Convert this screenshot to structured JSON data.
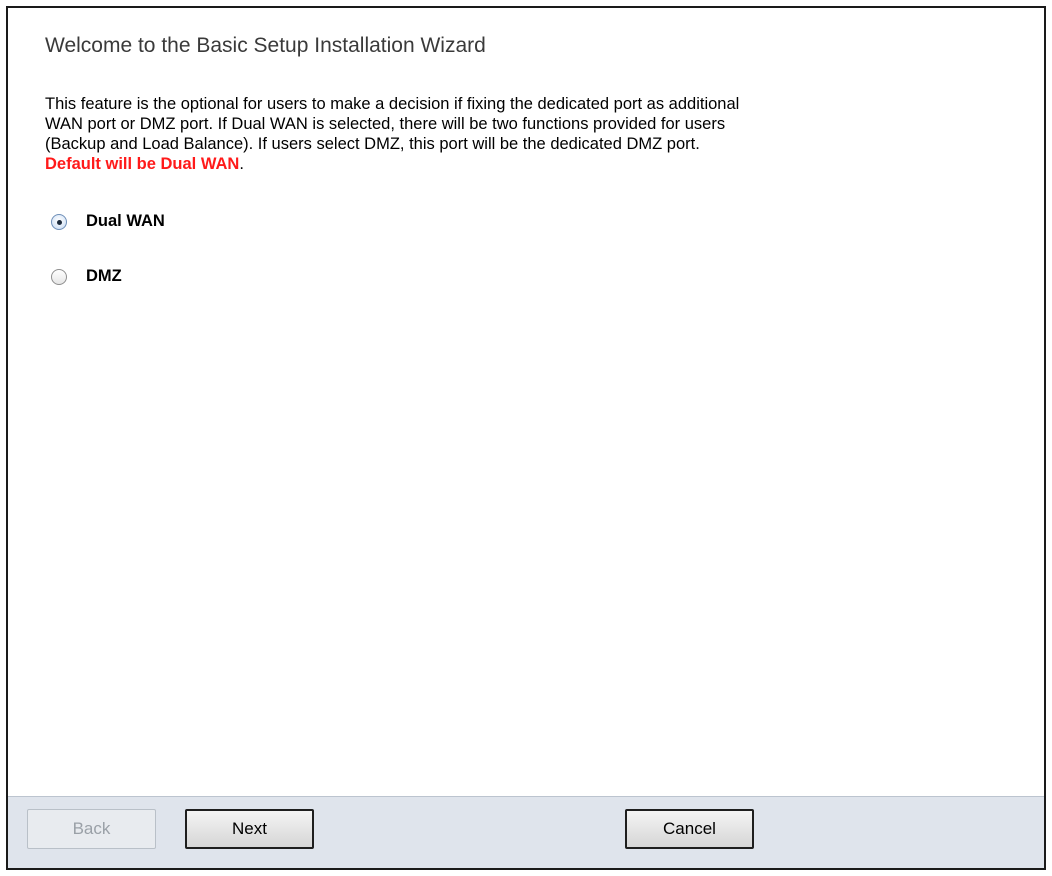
{
  "wizard": {
    "title": "Welcome to the Basic Setup Installation Wizard",
    "description_lines": [
      "This feature is the optional for users to make a decision if fixing the dedicated port as additional",
      "WAN port or DMZ port. If Dual WAN is selected, there will be two functions provided for users",
      "(Backup and Load Balance). If users select DMZ, this port will be the dedicated DMZ port."
    ],
    "default_note": "Default will be Dual WAN",
    "default_note_suffix": ".",
    "options": [
      {
        "label": "Dual WAN",
        "selected": true
      },
      {
        "label": "DMZ",
        "selected": false
      }
    ]
  },
  "footer": {
    "back_label": "Back",
    "next_label": "Next",
    "cancel_label": "Cancel"
  },
  "colors": {
    "default_note": "#ff1a1a",
    "footer_background": "#dfe4ec",
    "title_text": "#3a3a3a"
  }
}
